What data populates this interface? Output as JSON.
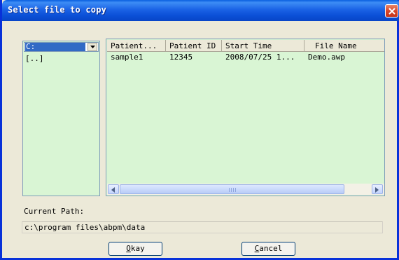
{
  "window": {
    "title": "Select file to copy"
  },
  "drive": {
    "selected": "C:",
    "dir_items": [
      "[..]"
    ]
  },
  "table": {
    "columns": [
      "Patient...",
      "Patient ID",
      "Start Time",
      "File Name"
    ],
    "rows": [
      [
        "sample1",
        "12345",
        "2008/07/25 1...",
        "Demo.awp"
      ]
    ]
  },
  "path": {
    "label": "Current Path:",
    "value": "c:\\program files\\abpm\\data"
  },
  "buttons": {
    "okay_hotkey": "O",
    "okay_rest": "kay",
    "cancel_hotkey": "C",
    "cancel_rest": "ancel"
  },
  "colors": {
    "list_bg": "#d9f5d4",
    "selection": "#316ac5",
    "titlebar": "#0a4fd6"
  },
  "icons": {
    "close": "close-icon",
    "dropdown": "chevron-down-icon",
    "scroll_left": "arrow-left-icon",
    "scroll_right": "arrow-right-icon"
  }
}
